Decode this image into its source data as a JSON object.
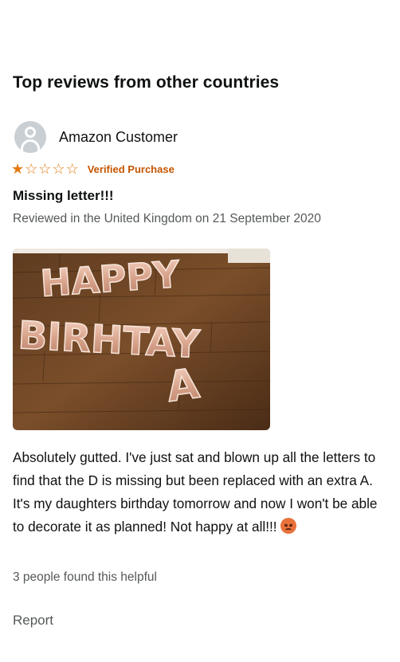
{
  "section": {
    "title": "Top reviews from other countries"
  },
  "review": {
    "author": "Amazon Customer",
    "rating": 1,
    "max_rating": 5,
    "verified_label": "Verified Purchase",
    "title": "Missing letter!!!",
    "meta": "Reviewed in the United Kingdom on 21 September 2020",
    "body": "Absolutely gutted. I've just sat and blown up all the letters to find that the D is missing but been replaced with an extra A. It's my daughters birthday tomorrow and now I won't be able to decorate it as planned! Not happy at all!!!",
    "emoji": "angry-face-emoji",
    "helpful_text": "3 people found this helpful",
    "report_label": "Report",
    "photo": {
      "balloon_line_1": "HAPPY",
      "balloon_line_2": "BIRHTAY",
      "balloon_line_3": "A"
    }
  },
  "colors": {
    "star": "#e47911",
    "verified": "#c45500",
    "meta_text": "#565959",
    "avatar_bg": "#c9cfd3"
  }
}
